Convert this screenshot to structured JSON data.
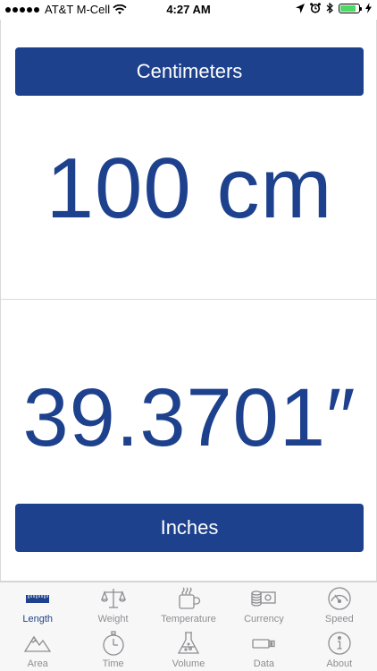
{
  "status_bar": {
    "carrier": "AT&T M-Cell",
    "time": "4:27 AM",
    "battery_level": 0.85,
    "battery_color": "#4cd964"
  },
  "converter": {
    "from_unit": "Centimeters",
    "from_value": "100 cm",
    "to_value": "39.3701″",
    "to_unit": "Inches",
    "accent_color": "#1d418d"
  },
  "tabs": [
    {
      "label": "Length",
      "icon": "ruler-icon",
      "active": true
    },
    {
      "label": "Weight",
      "icon": "scale-icon",
      "active": false
    },
    {
      "label": "Temperature",
      "icon": "mug-icon",
      "active": false
    },
    {
      "label": "Currency",
      "icon": "money-icon",
      "active": false
    },
    {
      "label": "Speed",
      "icon": "speedometer-icon",
      "active": false
    },
    {
      "label": "Area",
      "icon": "mountain-icon",
      "active": false
    },
    {
      "label": "Time",
      "icon": "stopwatch-icon",
      "active": false
    },
    {
      "label": "Volume",
      "icon": "flask-icon",
      "active": false
    },
    {
      "label": "Data",
      "icon": "usb-drive-icon",
      "active": false
    },
    {
      "label": "About",
      "icon": "info-icon",
      "active": false
    }
  ]
}
